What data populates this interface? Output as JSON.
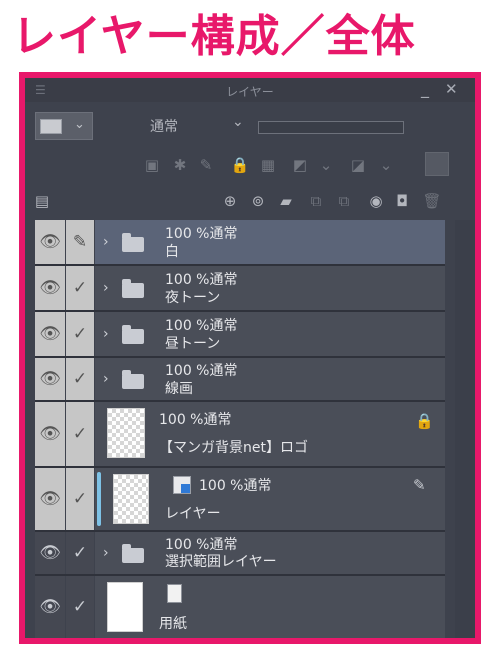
{
  "heading": "レイヤー構成／全体",
  "panel": {
    "menu_icon": "hamburger-icon",
    "title": "レイヤー",
    "minimize": "_",
    "close": "✕",
    "blend_mode": "通常",
    "blend_chevron": "⌄",
    "color_chevron": "⌄"
  },
  "colors": {
    "accent": "#e8186a",
    "selected_row": "#5b6478",
    "clip_bar": "#7ec2e6"
  },
  "layers": [
    {
      "type": "folder",
      "mode": "100 %通常",
      "name": "白",
      "selected": true,
      "edit_icon": "pen-icon"
    },
    {
      "type": "folder",
      "mode": "100 %通常",
      "name": "夜トーン"
    },
    {
      "type": "folder",
      "mode": "100 %通常",
      "name": "昼トーン"
    },
    {
      "type": "folder",
      "mode": "100 %通常",
      "name": "線画"
    },
    {
      "type": "raster",
      "mode": "100 %通常",
      "name": "【マンガ背景net】ロゴ",
      "locked": true
    },
    {
      "type": "tone",
      "mode": "100 %通常",
      "name": "レイヤー",
      "mask_icon": "layer-mask-icon"
    },
    {
      "type": "folder",
      "mode": "100 %通常",
      "name": "選択範囲レイヤー",
      "hidden_visibility": true
    },
    {
      "type": "paper",
      "name": "用紙",
      "hidden_visibility": true
    }
  ],
  "glyphs": {
    "eye": "👁",
    "check": "✓",
    "arrow": "›",
    "lock": "🔒",
    "pen": "✎"
  }
}
